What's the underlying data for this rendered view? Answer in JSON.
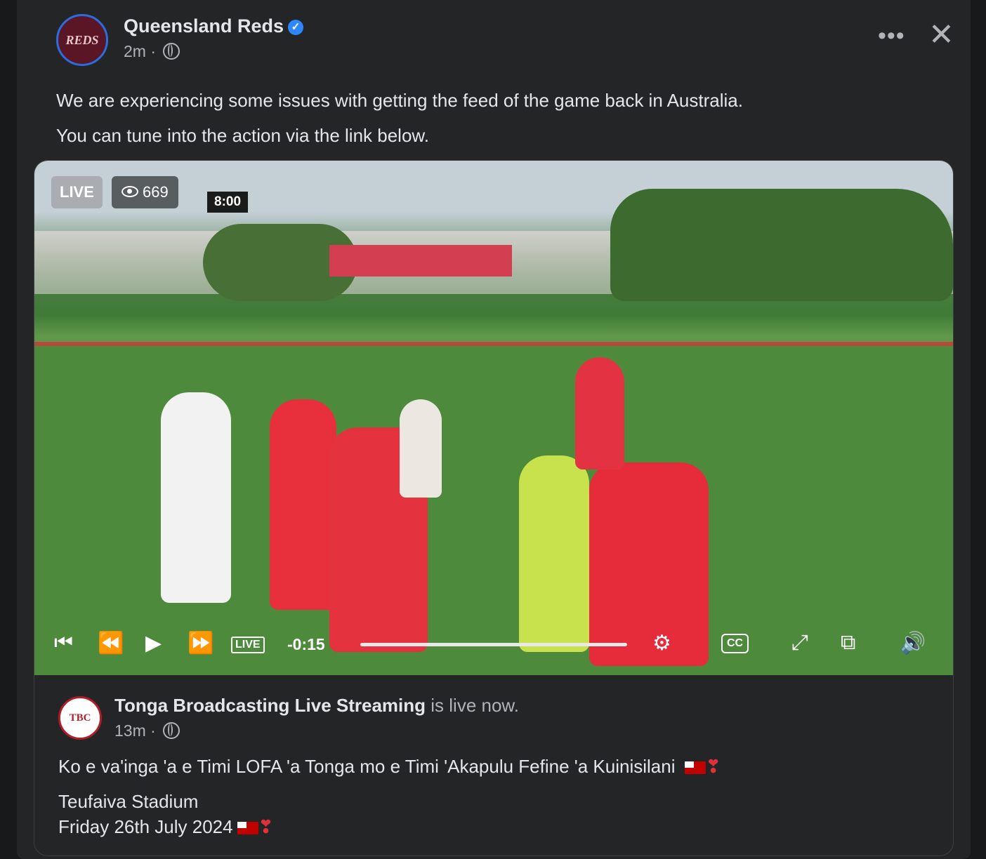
{
  "post": {
    "author": "Queensland Reds",
    "time": "2m",
    "avatar_text": "REDS",
    "more_label": "•••",
    "close_label": "✕",
    "line1": "We are experiencing some issues with getting the feed of the game back in Australia.",
    "line2": "You can tune into the action via the link below."
  },
  "video": {
    "live_label": "LIVE",
    "viewers": "669",
    "scoreboard_clock": "8:00",
    "live_badge": "LIVE",
    "time_remaining": "-0:15",
    "cc_label": "CC",
    "progress": 1.0
  },
  "shared": {
    "page_name": "Tonga Broadcasting Live Streaming",
    "status": " is live now.",
    "time": "13m",
    "logo_text": "TBC",
    "description": "Ko e va'inga 'a e Timi LOFA 'a Tonga mo  e Timi 'Akapulu Fefine 'a Kuinisilani",
    "venue": "Teufaiva Stadium",
    "date": "Friday 26th July 2024"
  },
  "colors": {
    "background": "#18191a",
    "card": "#242526",
    "text": "#e4e6eb",
    "secondary": "#b0b3b8",
    "verified": "#2d88ff"
  },
  "icons": [
    "globe-icon",
    "verified-icon",
    "eye-icon",
    "skip-back-icon",
    "rewind-icon",
    "play-icon",
    "fast-forward-icon",
    "settings-icon",
    "fullscreen-icon",
    "pip-icon",
    "volume-icon",
    "tonga-flag-icon",
    "heart-icon"
  ]
}
